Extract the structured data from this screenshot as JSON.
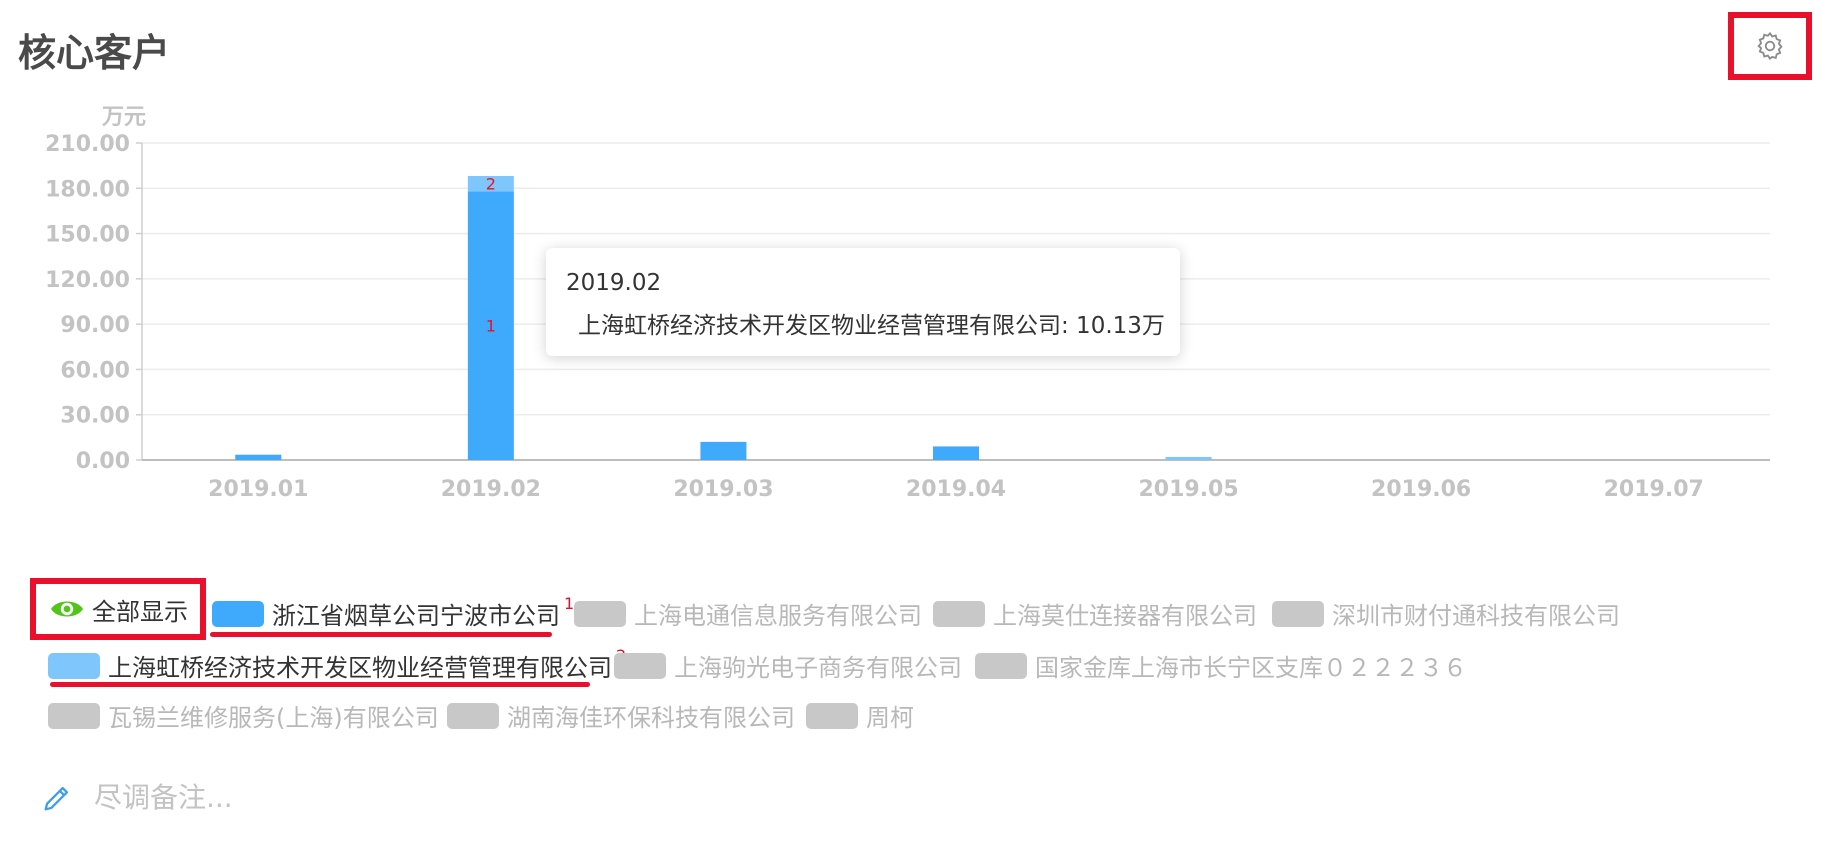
{
  "header": {
    "title": "核心客户"
  },
  "icons": {
    "settings": "gear-icon",
    "show_all": "eye-icon",
    "remark": "pencil-icon"
  },
  "colors": {
    "primary_bar": "#3fa9fb",
    "secondary_bar": "#7fc6fc",
    "disabled": "#c8c8c8",
    "accent_red": "#e8102a",
    "eye_green": "#52c41a",
    "pencil_blue": "#3d9dea"
  },
  "chart_data": {
    "type": "bar",
    "stacked": true,
    "unit_label": "万元",
    "categories": [
      "2019.01",
      "2019.02",
      "2019.03",
      "2019.04",
      "2019.05",
      "2019.06",
      "2019.07"
    ],
    "ylim": [
      0,
      210
    ],
    "yticks": [
      "0.00",
      "30.00",
      "60.00",
      "90.00",
      "120.00",
      "150.00",
      "180.00",
      "210.00"
    ],
    "grid": true,
    "series": [
      {
        "name": "浙江省烟草公司宁波市公司",
        "color": "#3fa9fb",
        "values": [
          3.5,
          178,
          12,
          9,
          0,
          0,
          0
        ],
        "marker": "1"
      },
      {
        "name": "上海虹桥经济技术开发区物业经营管理有限公司",
        "color": "#7fc6fc",
        "values": [
          0,
          10.13,
          0,
          0,
          2,
          0,
          0
        ],
        "marker": "2"
      }
    ]
  },
  "tooltip": {
    "date": "2019.02",
    "text": "上海虹桥经济技术开发区物业经营管理有限公司: 10.13万"
  },
  "legend": {
    "show_all_label": "全部显示",
    "items": [
      {
        "label": "浙江省烟草公司宁波市公司",
        "active": true,
        "color": "#3fa9fb",
        "mark": "1"
      },
      {
        "label": "上海电通信息服务有限公司",
        "active": false
      },
      {
        "label": "上海莫仕连接器有限公司",
        "active": false
      },
      {
        "label": "深圳市财付通科技有限公司",
        "active": false
      },
      {
        "label": "上海虹桥经济技术开发区物业经营管理有限公司",
        "active": true,
        "color": "#7fc6fc",
        "mark": "2"
      },
      {
        "label": "上海驹光电子商务有限公司",
        "active": false
      },
      {
        "label": "国家金库上海市长宁区支库０２２２３６",
        "active": false
      },
      {
        "label": "瓦锡兰维修服务(上海)有限公司",
        "active": false
      },
      {
        "label": "湖南海佳环保科技有限公司",
        "active": false
      },
      {
        "label": "周柯",
        "active": false
      }
    ]
  },
  "remark": {
    "placeholder": "尽调备注..."
  }
}
